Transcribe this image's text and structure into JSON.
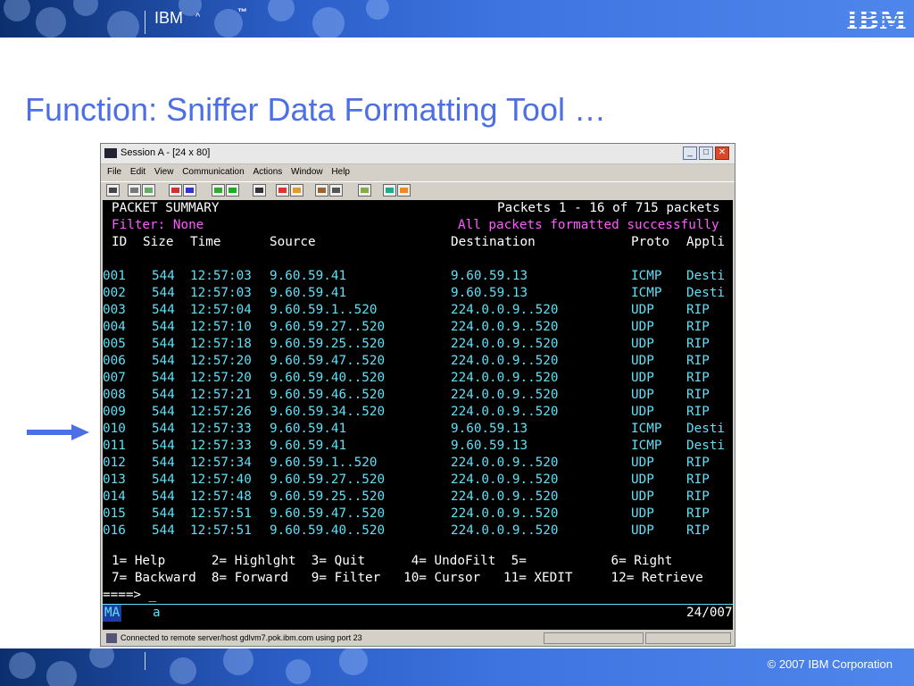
{
  "slide": {
    "brand": "IBM",
    "caret": "^",
    "tm": "™",
    "logo": "IBM",
    "title": "Function: Sniffer Data Formatting Tool …",
    "copyright": "© 2007 IBM Corporation"
  },
  "window": {
    "title": "Session A - [24 x 80]",
    "menu": [
      "File",
      "Edit",
      "View",
      "Communication",
      "Actions",
      "Window",
      "Help"
    ]
  },
  "terminal": {
    "header_left": "PACKET SUMMARY",
    "header_right": "Packets 1 - 16 of 715 packets",
    "filter": "Filter: None",
    "status_msg": "All packets formatted successfully",
    "columns": [
      "ID",
      "Size",
      "Time",
      "Source",
      "Destination",
      "Proto",
      "Appli"
    ],
    "rows": [
      [
        "001",
        "544",
        "12:57:03",
        "9.60.59.41",
        "9.60.59.13",
        "ICMP",
        "Desti"
      ],
      [
        "002",
        "544",
        "12:57:03",
        "9.60.59.41",
        "9.60.59.13",
        "ICMP",
        "Desti"
      ],
      [
        "003",
        "544",
        "12:57:04",
        "9.60.59.1..520",
        "224.0.0.9..520",
        "UDP",
        "RIP"
      ],
      [
        "004",
        "544",
        "12:57:10",
        "9.60.59.27..520",
        "224.0.0.9..520",
        "UDP",
        "RIP"
      ],
      [
        "005",
        "544",
        "12:57:18",
        "9.60.59.25..520",
        "224.0.0.9..520",
        "UDP",
        "RIP"
      ],
      [
        "006",
        "544",
        "12:57:20",
        "9.60.59.47..520",
        "224.0.0.9..520",
        "UDP",
        "RIP"
      ],
      [
        "007",
        "544",
        "12:57:20",
        "9.60.59.40..520",
        "224.0.0.9..520",
        "UDP",
        "RIP"
      ],
      [
        "008",
        "544",
        "12:57:21",
        "9.60.59.46..520",
        "224.0.0.9..520",
        "UDP",
        "RIP"
      ],
      [
        "009",
        "544",
        "12:57:26",
        "9.60.59.34..520",
        "224.0.0.9..520",
        "UDP",
        "RIP"
      ],
      [
        "010",
        "544",
        "12:57:33",
        "9.60.59.41",
        "9.60.59.13",
        "ICMP",
        "Desti"
      ],
      [
        "011",
        "544",
        "12:57:33",
        "9.60.59.41",
        "9.60.59.13",
        "ICMP",
        "Desti"
      ],
      [
        "012",
        "544",
        "12:57:34",
        "9.60.59.1..520",
        "224.0.0.9..520",
        "UDP",
        "RIP"
      ],
      [
        "013",
        "544",
        "12:57:40",
        "9.60.59.27..520",
        "224.0.0.9..520",
        "UDP",
        "RIP"
      ],
      [
        "014",
        "544",
        "12:57:48",
        "9.60.59.25..520",
        "224.0.0.9..520",
        "UDP",
        "RIP"
      ],
      [
        "015",
        "544",
        "12:57:51",
        "9.60.59.47..520",
        "224.0.0.9..520",
        "UDP",
        "RIP"
      ],
      [
        "016",
        "544",
        "12:57:51",
        "9.60.59.40..520",
        "224.0.0.9..520",
        "UDP",
        "RIP"
      ]
    ],
    "pf_line1": "1= Help      2= Highlght  3= Quit      4= UndoFilt  5=           6= Right",
    "pf_line2": "7= Backward  8= Forward   9= Filter   10= Cursor   11= XEDIT     12= Retrieve",
    "prompt": "====> _",
    "oia_left": "MA",
    "oia_mid": "a",
    "oia_right": "24/007"
  },
  "statusbar": {
    "text": "Connected to remote server/host gdlvm7.pok.ibm.com using port 23"
  }
}
